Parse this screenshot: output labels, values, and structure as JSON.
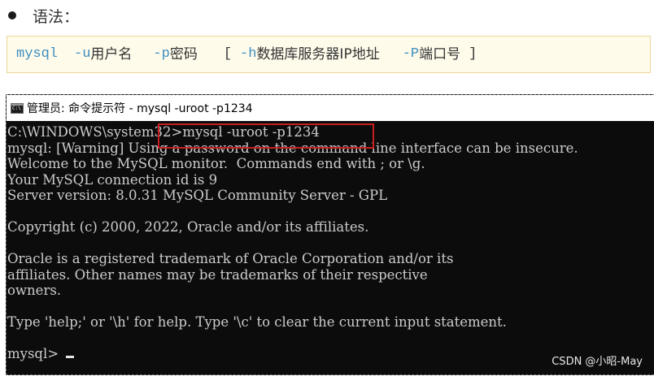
{
  "heading": {
    "text": "语法："
  },
  "syntax": {
    "cmd": "mysql",
    "u_flag": "-u",
    "u_label": "用户名",
    "p_flag": "-p",
    "p_label": "密码",
    "open_bracket": "[",
    "h_flag": "-h",
    "h_label": "数据库服务器IP地址",
    "port_flag": "-P",
    "port_label": "端口号",
    "close_bracket": "]"
  },
  "window": {
    "title": "管理员: 命令提示符 - mysql  -uroot -p1234"
  },
  "console": {
    "lines": [
      "C:\\WINDOWS\\system32>mysql -uroot -p1234",
      "mysql: [Warning] Using a password on the command line interface can be insecure.",
      "Welcome to the MySQL monitor.  Commands end with ; or \\g.",
      "Your MySQL connection id is 9",
      "Server version: 8.0.31 MySQL Community Server - GPL",
      "",
      "Copyright (c) 2000, 2022, Oracle and/or its affiliates.",
      "",
      "Oracle is a registered trademark of Oracle Corporation and/or its",
      "affiliates. Other names may be trademarks of their respective",
      "owners.",
      "",
      "Type 'help;' or '\\h' for help. Type '\\c' to clear the current input statement.",
      ""
    ],
    "prompt": "mysql> "
  },
  "watermark": "CSDN @小昭-May",
  "colors": {
    "syntax_blue": "#3c8fbf",
    "highlight_red": "#c81e1e",
    "console_bg": "#0c0c0c",
    "console_text": "#cccccc"
  }
}
